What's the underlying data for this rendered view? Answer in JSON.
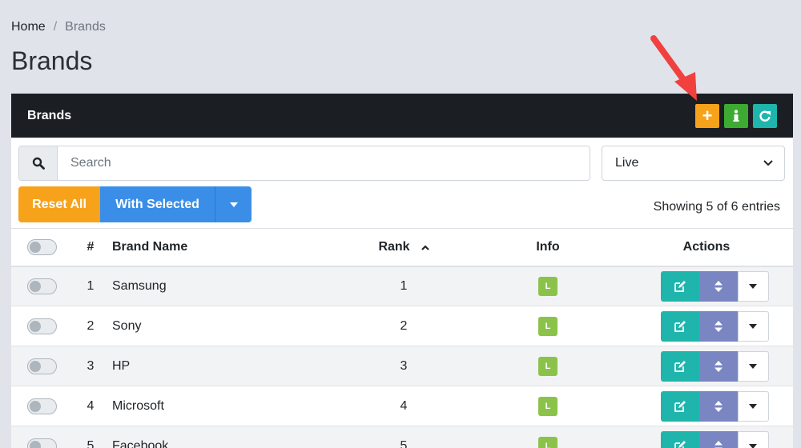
{
  "breadcrumb": {
    "home": "Home",
    "separator": "/",
    "current": "Brands"
  },
  "page_title": "Brands",
  "card": {
    "title": "Brands",
    "header_buttons": {
      "add": "+",
      "info": "i"
    }
  },
  "search": {
    "placeholder": "Search",
    "value": ""
  },
  "status_select": {
    "value": "Live"
  },
  "buttons": {
    "reset_all": "Reset All",
    "with_selected": "With Selected"
  },
  "showing_text": "Showing 5 of 6 entries",
  "table": {
    "headers": {
      "num": "#",
      "name": "Brand Name",
      "rank": "Rank",
      "info": "Info",
      "actions": "Actions"
    },
    "rows": [
      {
        "num": "1",
        "name": "Samsung",
        "rank": "1",
        "badge": "L"
      },
      {
        "num": "2",
        "name": "Sony",
        "rank": "2",
        "badge": "L"
      },
      {
        "num": "3",
        "name": "HP",
        "rank": "3",
        "badge": "L"
      },
      {
        "num": "4",
        "name": "Microsoft",
        "rank": "4",
        "badge": "L"
      },
      {
        "num": "5",
        "name": "Facebook",
        "rank": "5",
        "badge": "L"
      }
    ]
  },
  "colors": {
    "orange": "#f7a21b",
    "green": "#3dab31",
    "teal": "#1fb5ad",
    "blue": "#3b8ee8",
    "purple": "#7a86c2",
    "badge_green": "#8bc34a",
    "header_dark": "#1b1f23",
    "annotation_red": "#f0413f"
  },
  "icons": {
    "search": "search-icon",
    "chevron": "chevron-down-icon",
    "edit": "edit-icon",
    "move": "sort-icon",
    "refresh": "refresh-icon"
  }
}
